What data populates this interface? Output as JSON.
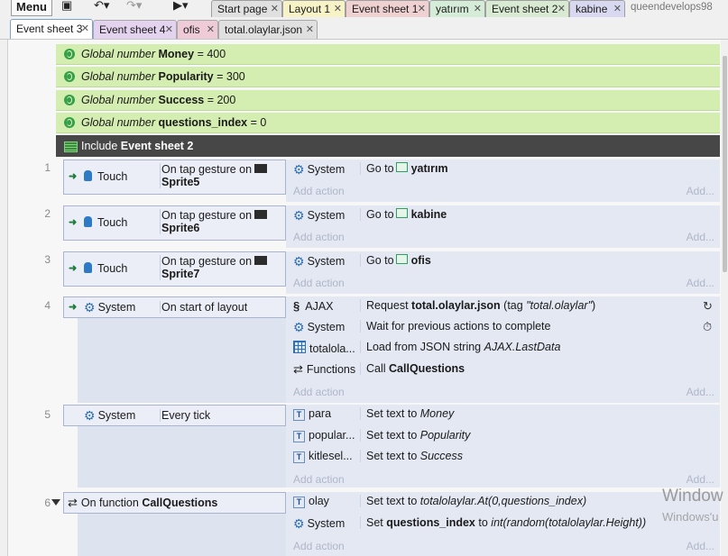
{
  "toolbar": {
    "menu": "Menu",
    "tabs": [
      "Start page",
      "Layout 1",
      "Event sheet 1",
      "yatırım",
      "Event sheet 2",
      "kabine"
    ],
    "user": "queendevelops98"
  },
  "subtabs": [
    "Event sheet 3",
    "Event sheet 4",
    "ofis",
    "total.olaylar.json"
  ],
  "globals": [
    {
      "kw": "Global number",
      "name": "Money",
      "val": "= 400"
    },
    {
      "kw": "Global number",
      "name": "Popularity",
      "val": "= 300"
    },
    {
      "kw": "Global number",
      "name": "Success",
      "val": "= 200"
    },
    {
      "kw": "Global number",
      "name": "questions_index",
      "val": "= 0"
    }
  ],
  "include": {
    "prefix": "Include",
    "name": "Event sheet 2"
  },
  "add_action": "Add action",
  "add_action_short": "Add...",
  "events": [
    {
      "num": "1",
      "obj": "Touch",
      "cond": "On tap gesture on",
      "target": "Sprite5",
      "actions": [
        {
          "obj": "System",
          "pre": "Go to",
          "bold": "yatırım"
        }
      ]
    },
    {
      "num": "2",
      "obj": "Touch",
      "cond": "On tap gesture on",
      "target": "Sprite6",
      "actions": [
        {
          "obj": "System",
          "pre": "Go to",
          "bold": "kabine"
        }
      ]
    },
    {
      "num": "3",
      "obj": "Touch",
      "cond": "On tap gesture on",
      "target": "Sprite7",
      "actions": [
        {
          "obj": "System",
          "pre": "Go to",
          "bold": "ofis"
        }
      ]
    },
    {
      "num": "4",
      "obj": "System",
      "cond": "On start of layout",
      "actions": [
        {
          "obj": "AJAX",
          "pre": "Request",
          "bold": "total.olaylar.json",
          "post": "(tag",
          "ital": "\"total.olaylar\"",
          "post2": ")"
        },
        {
          "obj": "System",
          "pre": "Wait for previous actions to complete"
        },
        {
          "obj": "totalola...",
          "pre": "Load from JSON string",
          "ital": "AJAX.LastData"
        },
        {
          "obj": "Functions",
          "pre": "Call",
          "bold": "CallQuestions"
        }
      ]
    },
    {
      "num": "5",
      "obj": "System",
      "cond": "Every tick",
      "actions": [
        {
          "obj": "para",
          "pre": "Set text to",
          "ital": "Money"
        },
        {
          "obj": "popular...",
          "pre": "Set text to",
          "ital": "Popularity"
        },
        {
          "obj": "kitlesel...",
          "pre": "Set text to",
          "ital": "Success"
        }
      ]
    },
    {
      "num": "6",
      "prefix": "On function",
      "bold": "CallQuestions",
      "actions": [
        {
          "obj": "olay",
          "pre": "Set text to",
          "ital": "totalolaylar.At(0,questions_index)"
        },
        {
          "obj": "System",
          "pre": "Set",
          "bold": "questions_index",
          "post": "to",
          "ital": "int(random(totalolaylar.Height))"
        }
      ]
    }
  ],
  "watermark": {
    "line1": "Window",
    "line2": "Windows'u"
  }
}
